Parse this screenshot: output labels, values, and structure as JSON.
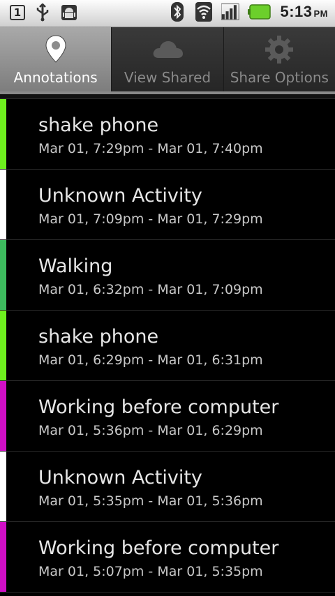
{
  "status_bar": {
    "notif_count": "1",
    "time": "5:13",
    "ampm": "PM",
    "battery_color": "#6ccf2b"
  },
  "tabs": [
    {
      "label": "Annotations",
      "icon": "location-pin-icon",
      "active": true
    },
    {
      "label": "View Shared",
      "icon": "cloud-icon",
      "active": false
    },
    {
      "label": "Share Options",
      "icon": "gear-icon",
      "active": false
    }
  ],
  "annotations": [
    {
      "title": "shake phone",
      "time": "Mar 01, 7:29pm - Mar 01, 7:40pm",
      "color": "#6ef01e"
    },
    {
      "title": "Unknown Activity",
      "time": "Mar 01, 7:09pm - Mar 01, 7:29pm",
      "color": "#ffffff"
    },
    {
      "title": "Walking",
      "time": "Mar 01, 6:32pm - Mar 01, 7:09pm",
      "color": "#3dbb5e"
    },
    {
      "title": "shake phone",
      "time": "Mar 01, 6:29pm - Mar 01, 6:31pm",
      "color": "#6ef01e"
    },
    {
      "title": "Working before computer",
      "time": "Mar 01, 5:36pm - Mar 01, 6:29pm",
      "color": "#d10fc6"
    },
    {
      "title": "Unknown Activity",
      "time": "Mar 01, 5:35pm - Mar 01, 5:36pm",
      "color": "#ffffff"
    },
    {
      "title": "Working before computer",
      "time": "Mar 01, 5:07pm - Mar 01, 5:35pm",
      "color": "#d10fc6"
    }
  ]
}
